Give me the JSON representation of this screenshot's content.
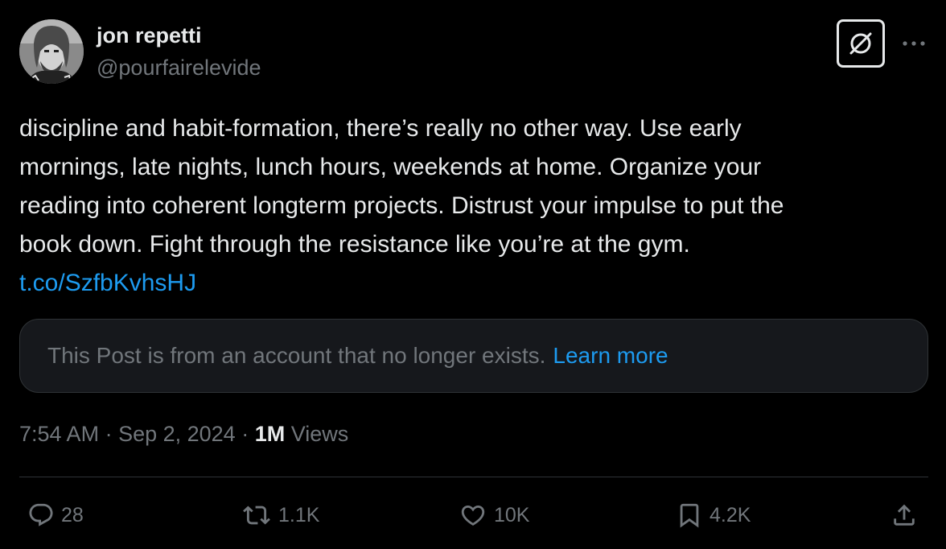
{
  "author": {
    "name": "jon repetti",
    "handle": "@pourfairelevide",
    "avatar_icon": "user-photo-icon"
  },
  "header_actions": {
    "grok_icon": "grok-icon",
    "more_icon": "more-dots-icon"
  },
  "tweet": {
    "lines": [
      "discipline and habit-formation, there’s really no other way. Use early",
      "mornings, late nights, lunch hours, weekends at home. Organize your",
      "reading into coherent longterm projects. Distrust your impulse to put the",
      "book down. Fight through the resistance like you’re at the gym."
    ],
    "link": "t.co/SzfbKvhsHJ"
  },
  "notice": {
    "text": "This Post is from an account that no longer exists.",
    "link_label": "Learn more"
  },
  "meta": {
    "time": "7:54 AM",
    "separator": " · ",
    "date": "Sep 2, 2024",
    "views_count": "1M",
    "views_label": "Views"
  },
  "actions": {
    "replies": "28",
    "reposts": "1.1K",
    "likes": "10K",
    "bookmarks": "4.2K",
    "reply_icon": "reply-icon",
    "repost_icon": "repost-icon",
    "like_icon": "heart-icon",
    "bookmark_icon": "bookmark-icon",
    "share_icon": "share-icon"
  },
  "colors": {
    "background": "#000000",
    "text_primary": "#e7e9ea",
    "text_secondary": "#71767b",
    "accent": "#1d9bf0",
    "border": "#2f3336",
    "notice_bg": "#16181c"
  }
}
